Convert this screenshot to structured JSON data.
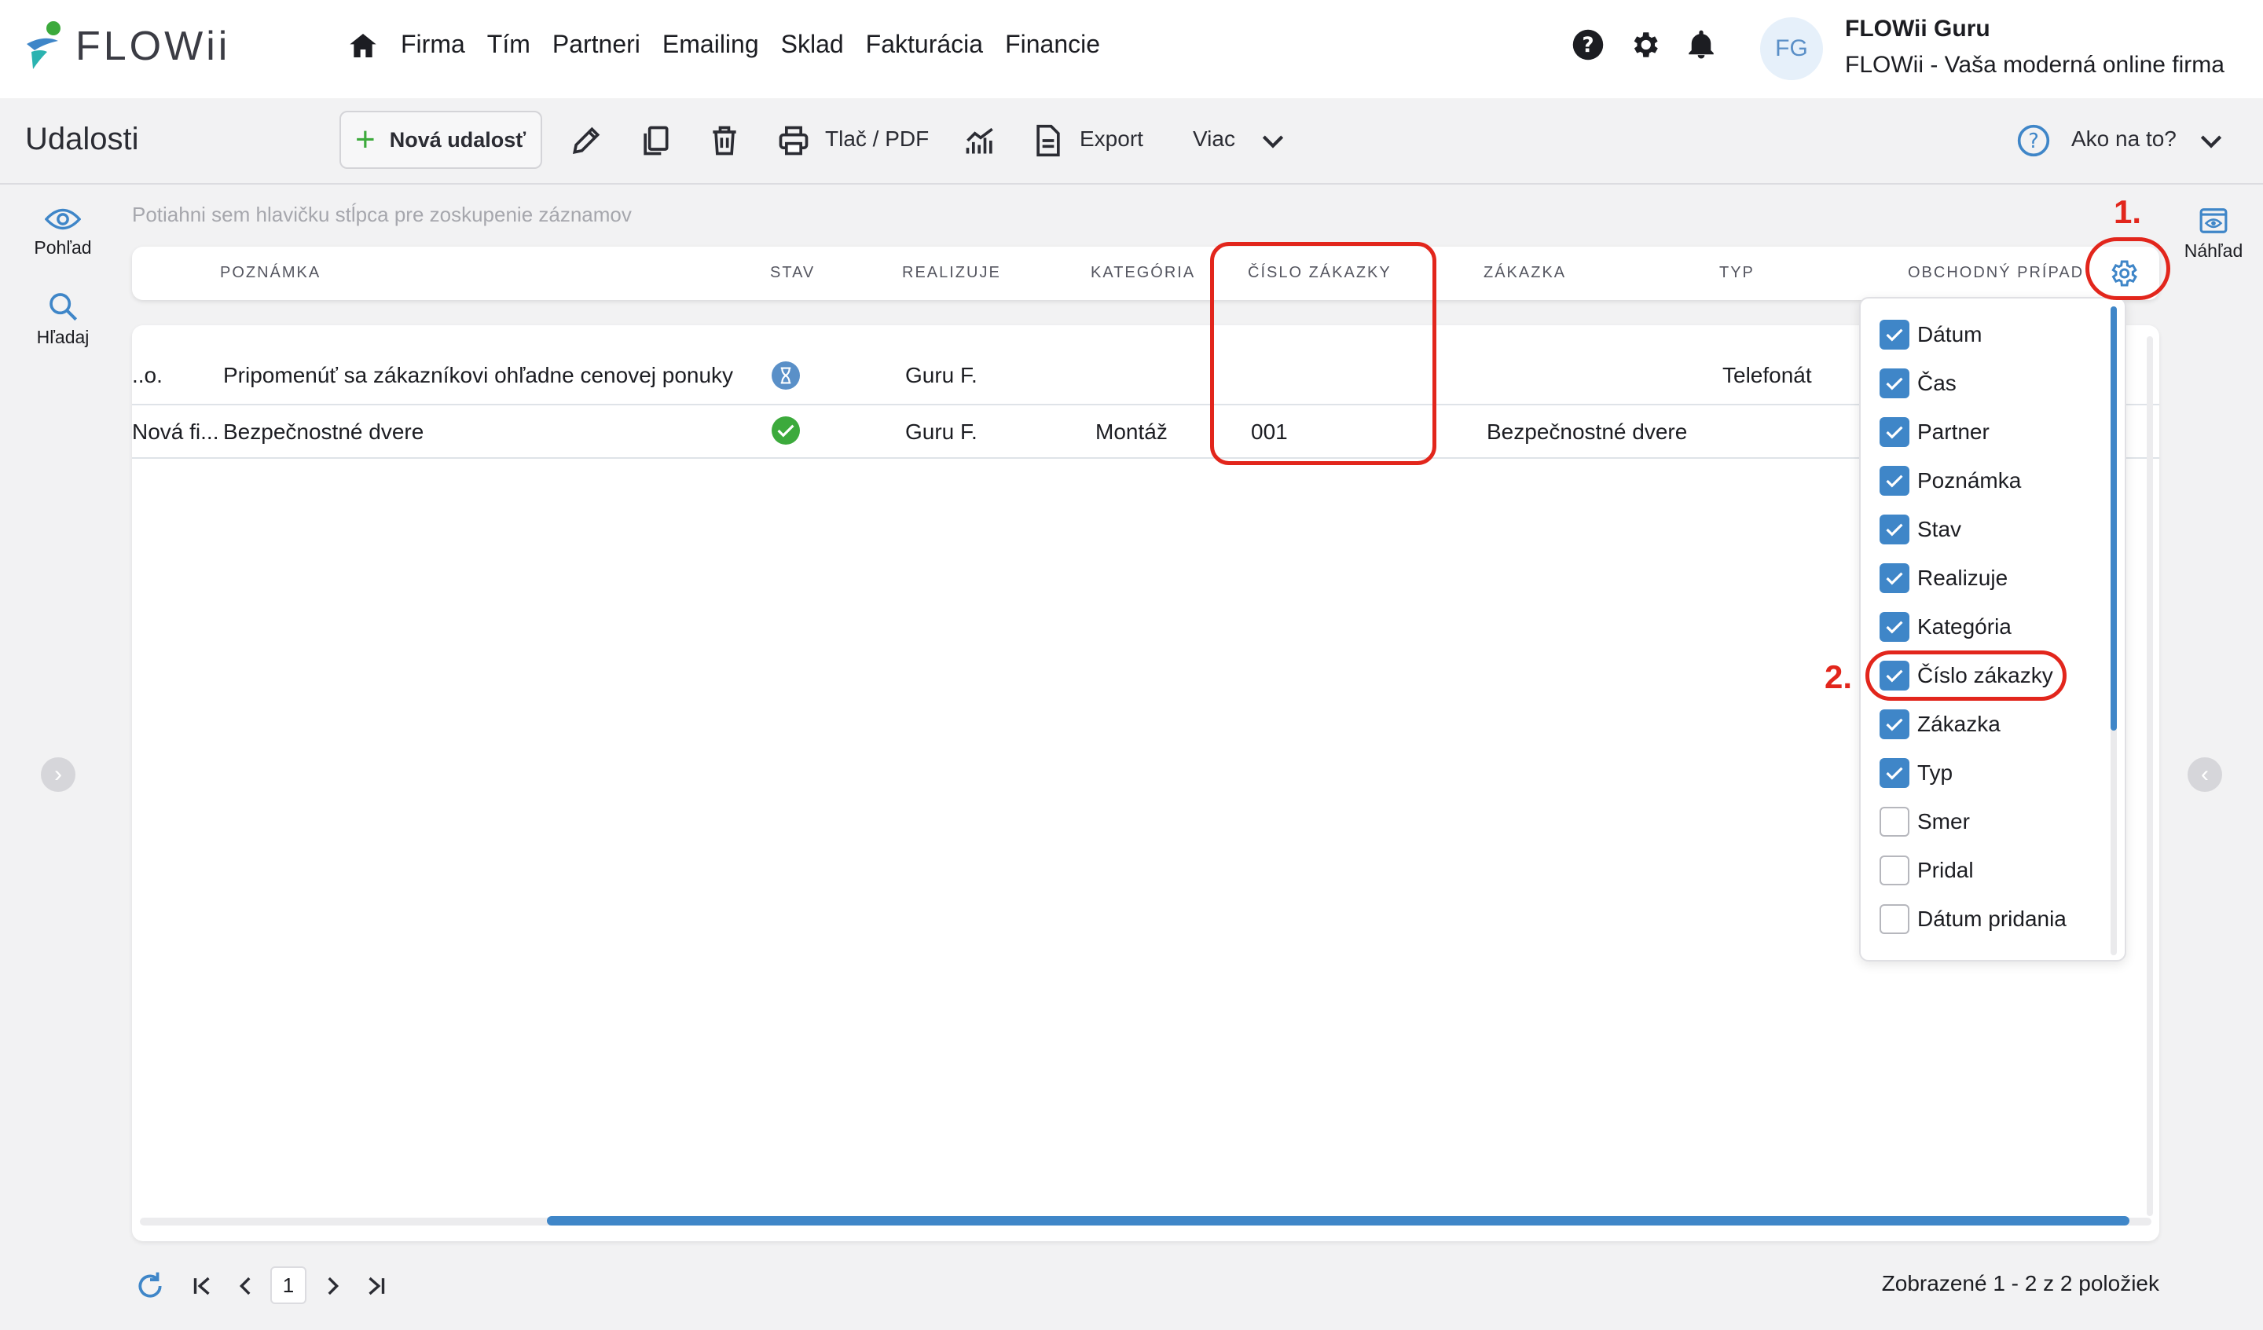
{
  "brand": {
    "name": "FLOWii"
  },
  "nav": {
    "items": [
      "Firma",
      "Tím",
      "Partneri",
      "Emailing",
      "Sklad",
      "Fakturácia",
      "Financie"
    ]
  },
  "user": {
    "initials": "FG",
    "name": "FLOWii Guru",
    "company": "FLOWii - Vaša moderná online firma"
  },
  "toolbar": {
    "title": "Udalosti",
    "new_label": "Nová udalosť",
    "print_label": "Tlač / PDF",
    "export_label": "Export",
    "more_label": "Viac",
    "help_label": "Ako na to?"
  },
  "rail": {
    "view_label": "Pohľad",
    "search_label": "Hľadaj",
    "preview_label": "Náhľad"
  },
  "grid": {
    "group_hint": "Potiahni sem hlavičku stĺpca pre zoskupenie záznamov",
    "columns": [
      "POZNÁMKA",
      "STAV",
      "REALIZUJE",
      "KATEGÓRIA",
      "ČÍSLO ZÁKAZKY",
      "ZÁKAZKA",
      "TYP",
      "OBCHODNÝ PRÍPAD"
    ],
    "rows": [
      {
        "partner": "..o.",
        "note": "Pripomenúť sa zákazníkovi ohľadne cenovej ponuky",
        "status": "pending",
        "assignee": "Guru F.",
        "category": "",
        "order_no": "",
        "order": "",
        "type": "Telefonát"
      },
      {
        "partner": "Nová fi...",
        "note": "Bezpečnostné dvere",
        "status": "done",
        "assignee": "Guru F.",
        "category": "Montáž",
        "order_no": "001",
        "order": "Bezpečnostné dvere",
        "type": ""
      }
    ]
  },
  "column_chooser": {
    "options": [
      {
        "label": "Dátum",
        "checked": true
      },
      {
        "label": "Čas",
        "checked": true
      },
      {
        "label": "Partner",
        "checked": true
      },
      {
        "label": "Poznámka",
        "checked": true
      },
      {
        "label": "Stav",
        "checked": true
      },
      {
        "label": "Realizuje",
        "checked": true
      },
      {
        "label": "Kategória",
        "checked": true
      },
      {
        "label": "Číslo zákazky",
        "checked": true
      },
      {
        "label": "Zákazka",
        "checked": true
      },
      {
        "label": "Typ",
        "checked": true
      },
      {
        "label": "Smer",
        "checked": false
      },
      {
        "label": "Pridal",
        "checked": false
      },
      {
        "label": "Dátum pridania",
        "checked": false
      }
    ]
  },
  "annotations": {
    "step1": "1.",
    "step2": "2."
  },
  "pager": {
    "current_page": "1",
    "summary": "Zobrazené 1 - 2 z 2 položiek"
  },
  "colors": {
    "accent": "#3f86c8",
    "success": "#3caa3c",
    "annotation": "#e2261c"
  }
}
